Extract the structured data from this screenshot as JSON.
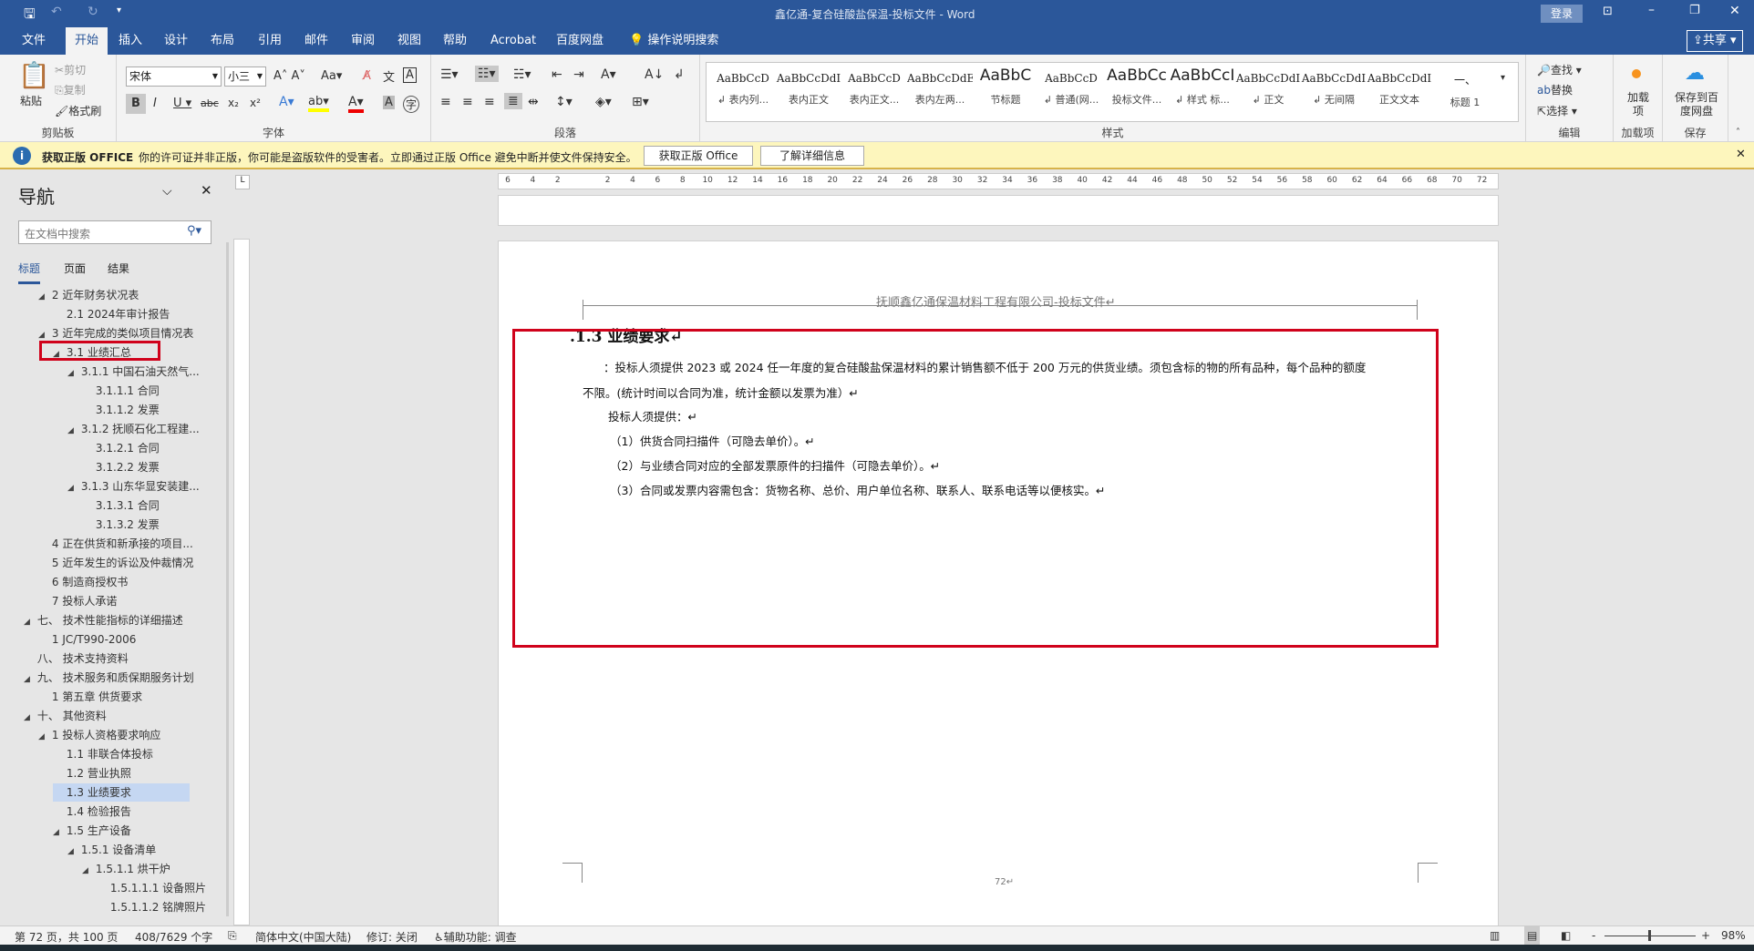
{
  "titlebar": {
    "title": "鑫亿通-复合硅酸盐保温-投标文件  -  Word",
    "login": "登录"
  },
  "tabs": [
    "文件",
    "开始",
    "插入",
    "设计",
    "布局",
    "引用",
    "邮件",
    "审阅",
    "视图",
    "帮助",
    "Acrobat",
    "百度网盘"
  ],
  "tell_me": "操作说明搜索",
  "share": "共享",
  "ribbon": {
    "clipboard": {
      "paste": "粘贴",
      "cut": "剪切",
      "copy": "复制",
      "format_painter": "格式刷",
      "label": "剪贴板"
    },
    "font": {
      "name": "宋体",
      "size": "小三",
      "label": "字体"
    },
    "paragraph": {
      "label": "段落"
    },
    "styles": {
      "label": "样式",
      "items": [
        {
          "preview": "AaBbCcD",
          "name": "↲ 表内列..."
        },
        {
          "preview": "AaBbCcDdI",
          "name": "表内正文"
        },
        {
          "preview": "AaBbCcD",
          "name": "表内正文..."
        },
        {
          "preview": "AaBbCcDdEe",
          "name": "表内左两..."
        },
        {
          "preview": "AaBbC",
          "name": "节标题"
        },
        {
          "preview": "AaBbCcD",
          "name": "↲ 普通(网..."
        },
        {
          "preview": "AaBbCc",
          "name": "投标文件..."
        },
        {
          "preview": "AaBbCcI",
          "name": "↲ 样式 标..."
        },
        {
          "preview": "AaBbCcDdI",
          "name": "↲ 正文"
        },
        {
          "preview": "AaBbCcDdI",
          "name": "↲ 无间隔"
        },
        {
          "preview": "AaBbCcDdI",
          "name": "正文文本"
        },
        {
          "preview": "一、",
          "name": "标题 1"
        }
      ]
    },
    "editing": {
      "find": "查找",
      "replace": "替换",
      "select": "选择",
      "label": "编辑"
    },
    "addins": {
      "button": "加载项",
      "label": "加载项"
    },
    "save": {
      "button": "保存到百度网盘",
      "label": "保存"
    }
  },
  "infobar": {
    "title": "获取正版 OFFICE",
    "message": "你的许可证并非正版，你可能是盗版软件的受害者。立即通过正版 Office 避免中断并使文件保持安全。",
    "btn1": "获取正版 Office",
    "btn2": "了解详细信息"
  },
  "nav": {
    "title": "导航",
    "search_placeholder": "在文档中搜索",
    "tabs": [
      "标题",
      "页面",
      "结果"
    ],
    "items": [
      {
        "t": "2 近年财务状况表",
        "l": 1,
        "c": true
      },
      {
        "t": "2.1 2024年审计报告",
        "l": 2,
        "c": false
      },
      {
        "t": "3 近年完成的类似项目情况表",
        "l": 1,
        "c": true
      },
      {
        "t": "3.1 业绩汇总",
        "l": 2,
        "c": true
      },
      {
        "t": "3.1.1 中国石油天然气...",
        "l": 3,
        "c": true
      },
      {
        "t": "3.1.1.1 合同",
        "l": 4,
        "c": false
      },
      {
        "t": "3.1.1.2 发票",
        "l": 4,
        "c": false
      },
      {
        "t": "3.1.2 抚顺石化工程建...",
        "l": 3,
        "c": true
      },
      {
        "t": "3.1.2.1 合同",
        "l": 4,
        "c": false
      },
      {
        "t": "3.1.2.2 发票",
        "l": 4,
        "c": false
      },
      {
        "t": "3.1.3 山东华显安装建...",
        "l": 3,
        "c": true
      },
      {
        "t": "3.1.3.1 合同",
        "l": 4,
        "c": false
      },
      {
        "t": "3.1.3.2 发票",
        "l": 4,
        "c": false
      },
      {
        "t": "4 正在供货和新承接的项目...",
        "l": 1,
        "c": false
      },
      {
        "t": "5 近年发生的诉讼及仲裁情况",
        "l": 1,
        "c": false
      },
      {
        "t": "6 制造商授权书",
        "l": 1,
        "c": false
      },
      {
        "t": "7 投标人承诺",
        "l": 1,
        "c": false
      },
      {
        "t": "七、 技术性能指标的详细描述",
        "l": 0,
        "c": true
      },
      {
        "t": "1 JC/T990-2006",
        "l": 1,
        "c": false
      },
      {
        "t": "八、 技术支持资料",
        "l": 0,
        "c": false
      },
      {
        "t": "九、 技术服务和质保期服务计划",
        "l": 0,
        "c": true
      },
      {
        "t": "1 第五章  供货要求",
        "l": 1,
        "c": false
      },
      {
        "t": "十、 其他资料",
        "l": 0,
        "c": true
      },
      {
        "t": "1 投标人资格要求响应",
        "l": 1,
        "c": true
      },
      {
        "t": "1.1 非联合体投标",
        "l": 2,
        "c": false
      },
      {
        "t": "1.2 营业执照",
        "l": 2,
        "c": false
      },
      {
        "t": "1.3 业绩要求",
        "l": 2,
        "c": false,
        "sel": true
      },
      {
        "t": "1.4 检验报告",
        "l": 2,
        "c": false
      },
      {
        "t": "1.5 生产设备",
        "l": 2,
        "c": true
      },
      {
        "t": "1.5.1 设备清单",
        "l": 3,
        "c": true
      },
      {
        "t": "1.5.1.1 烘干炉",
        "l": 4,
        "c": true
      },
      {
        "t": "1.5.1.1.1 设备照片",
        "l": 5,
        "c": false
      },
      {
        "t": "1.5.1.1.2 铭牌照片",
        "l": 5,
        "c": false
      }
    ]
  },
  "ruler": [
    "6",
    "4",
    "2",
    "",
    "2",
    "4",
    "6",
    "8",
    "10",
    "12",
    "14",
    "16",
    "18",
    "20",
    "22",
    "24",
    "26",
    "28",
    "30",
    "32",
    "34",
    "36",
    "38",
    "40",
    "42",
    "44",
    "46",
    "48",
    "50",
    "52",
    "54",
    "56",
    "58",
    "60",
    "62",
    "64",
    "66",
    "68",
    "70",
    "72"
  ],
  "document": {
    "header": "抚顺鑫亿通保温材料工程有限公司-投标文件↵",
    "heading": ".1.3    业绩要求↵",
    "p1a": "：投标人须提供 2023 或 2024 任一年度的复合硅酸盐保温材料的累计销售额不低于 200 万元的供货业绩。须包含标的物的所有品种，每个品种的额度",
    "p1b": "不限。(统计时间以合同为准，统计金额以发票为准）↵",
    "p2": "投标人须提供：↵",
    "p3": "（1）供货合同扫描件（可隐去单价）。↵",
    "p4": "（2）与业绩合同对应的全部发票原件的扫描件（可隐去单价）。↵",
    "p5": "（3）合同或发票内容需包含：货物名称、总价、用户单位名称、联系人、联系电话等以便核实。↵",
    "page_number": "72↵"
  },
  "status": {
    "page": "第 72 页，共 100 页",
    "words": "408/7629 个字",
    "lang": "简体中文(中国大陆)",
    "track": "修订: 关闭",
    "access": "辅助功能: 调查",
    "zoom": "98%"
  },
  "colors": {
    "accent": "#2b579a",
    "highlight": "#d0021b"
  }
}
